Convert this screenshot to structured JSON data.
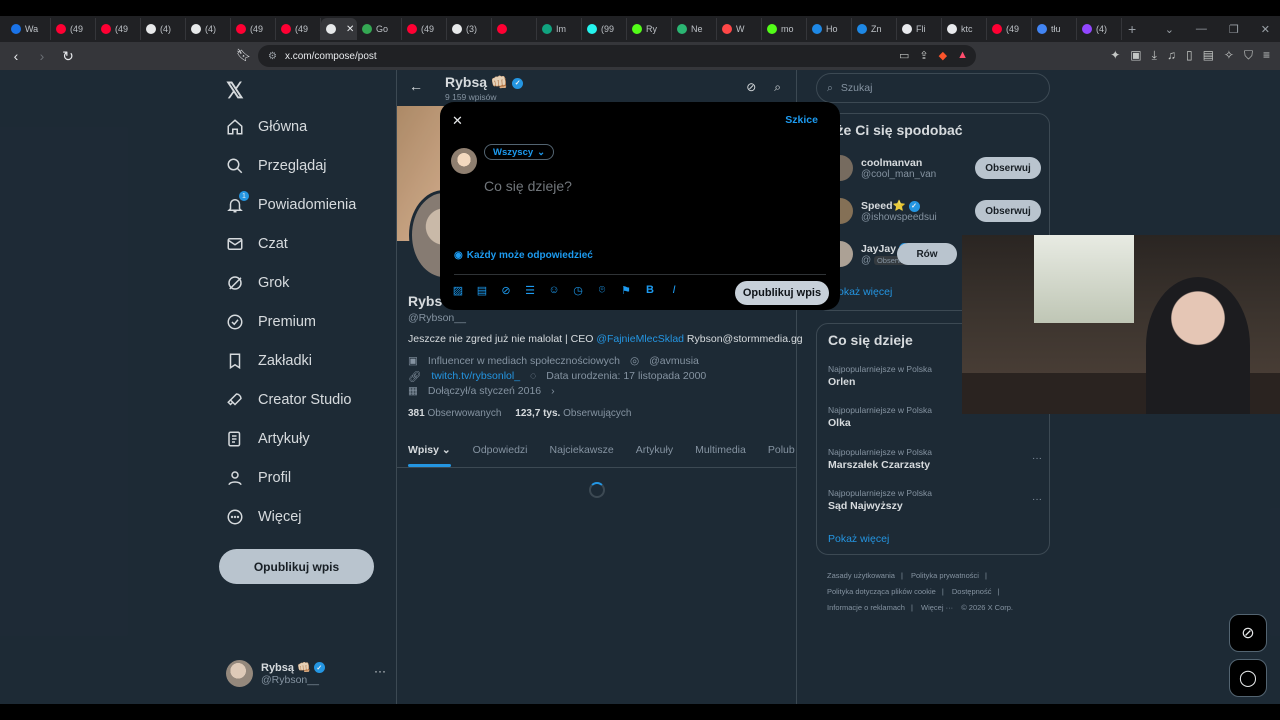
{
  "browser": {
    "tabs": [
      {
        "label": "Wa",
        "color": "#1a73e8"
      },
      {
        "label": "(49",
        "color": "#ff0033"
      },
      {
        "label": "(49",
        "color": "#ff0033"
      },
      {
        "label": "(4)",
        "color": "#e7e9ea"
      },
      {
        "label": "(4)",
        "color": "#e7e9ea"
      },
      {
        "label": "(49",
        "color": "#ff0033"
      },
      {
        "label": "(49",
        "color": "#ff0033"
      },
      {
        "label": "",
        "color": "#e7e9ea",
        "active": true
      },
      {
        "label": "Go",
        "color": "#34a853"
      },
      {
        "label": "(49",
        "color": "#ff0033"
      },
      {
        "label": "(3)",
        "color": "#e7e9ea"
      },
      {
        "label": "",
        "color": "#ff0033"
      },
      {
        "label": "Im",
        "color": "#10a37f"
      },
      {
        "label": "(99",
        "color": "#25f4ee"
      },
      {
        "label": "Ry",
        "color": "#53fc18"
      },
      {
        "label": "Ne",
        "color": "#2bb673"
      },
      {
        "label": "W",
        "color": "#ff4747"
      },
      {
        "label": "mo",
        "color": "#53fc18"
      },
      {
        "label": "Ho",
        "color": "#1e88e5"
      },
      {
        "label": "Zn",
        "color": "#1e88e5"
      },
      {
        "label": "Fli",
        "color": "#e8eaed"
      },
      {
        "label": "ktc",
        "color": "#e8eaed"
      },
      {
        "label": "(49",
        "color": "#ff0033"
      },
      {
        "label": "tłu",
        "color": "#4285f4"
      },
      {
        "label": "(4)",
        "color": "#9146ff"
      }
    ],
    "new_tab": "+",
    "url": "x.com/compose/post"
  },
  "nav": {
    "items": [
      {
        "label": "Główna",
        "icon": "home-icon"
      },
      {
        "label": "Przeglądaj",
        "icon": "search-icon"
      },
      {
        "label": "Powiadomienia",
        "icon": "bell-icon",
        "badge": "1"
      },
      {
        "label": "Czat",
        "icon": "mail-icon"
      },
      {
        "label": "Grok",
        "icon": "grok-icon"
      },
      {
        "label": "Premium",
        "icon": "premium-icon"
      },
      {
        "label": "Zakładki",
        "icon": "bookmark-icon"
      },
      {
        "label": "Creator Studio",
        "icon": "rocket-icon"
      },
      {
        "label": "Artykuły",
        "icon": "article-icon"
      },
      {
        "label": "Profil",
        "icon": "person-icon"
      },
      {
        "label": "Więcej",
        "icon": "more-circle-icon"
      }
    ],
    "post_button": "Opublikuj wpis",
    "account": {
      "name": "Rybsą 👊🏻",
      "handle": "@Rybson__"
    }
  },
  "profile": {
    "title": "Rybsą 👊🏻",
    "post_count": "9 159 wpisów",
    "name": "Rybs",
    "handle": "@Rybson__",
    "bio_prefix": "Jeszcze nie zgred już nie malolat | CEO ",
    "bio_link": "@FajnieMlecSklad",
    "bio_suffix": " Rybson@stormmedia.gg",
    "category": "Influencer w mediach społecznościowych",
    "location": "@avmusia",
    "website": "twitch.tv/rybsonlol_",
    "birthday": "Data urodzenia: 17 listopada 2000",
    "joined": "Dołączył/a styczeń 2016",
    "following_count": "381",
    "following_label": "Obserwowanych",
    "followers_count": "123,7 tys.",
    "followers_label": "Obserwujących",
    "tabs": [
      "Wpisy",
      "Odpowiedzi",
      "Najciekawsze",
      "Artykuły",
      "Multimedia",
      "Polub"
    ]
  },
  "right": {
    "search_placeholder": "Szukaj",
    "who_to_follow_title": "oże Ci się spodobać",
    "suggestions": [
      {
        "name": "coolmanvan",
        "handle": "@cool_man_van",
        "button": "Obserwuj"
      },
      {
        "name": "Speed⭐",
        "handle": "@ishowspeedsui",
        "button": "Obserwuj"
      },
      {
        "name": "JayJay",
        "handle": "@",
        "badge": "Obserwuje Cię",
        "button": "Rów"
      }
    ],
    "show_more": "okaż więcej",
    "trends_title": "Co się dzieje",
    "trends": [
      {
        "category": "Najpopularniejsze w Polska",
        "name": "Orlen"
      },
      {
        "category": "Najpopularniejsze w Polska",
        "name": "Olka"
      },
      {
        "category": "Najpopularniejsze w Polska",
        "name": "Marszałek Czarzasty"
      },
      {
        "category": "Najpopularniejsze w Polska",
        "name": "Sąd Najwyższy"
      }
    ],
    "trends_more": "Pokaż więcej",
    "footer": [
      "Zasady użytkowania",
      "|",
      "Polityka prywatności",
      "|",
      "Polityka dotycząca plików cookie",
      "|",
      "Dostępność",
      "|",
      "Informacje o reklamach",
      "|",
      "Więcej ···",
      "© 2026 X Corp."
    ]
  },
  "compose": {
    "drafts": "Szkice",
    "audience": "Wszyscy",
    "placeholder": "Co się dzieje?",
    "reply_setting": "Każdy może odpowiedzieć",
    "post_button": "Opublikuj wpis"
  }
}
